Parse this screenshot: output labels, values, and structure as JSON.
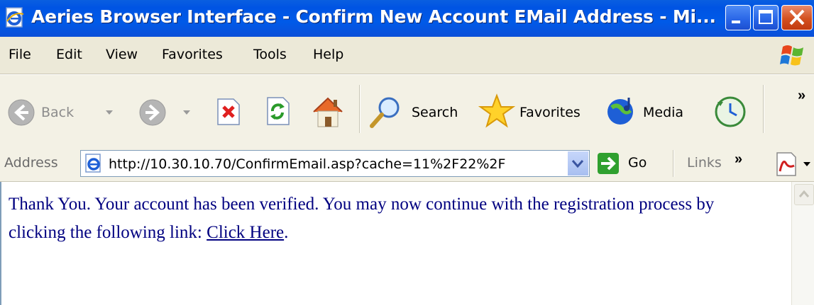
{
  "window": {
    "title": "Aeries Browser Interface - Confirm New Account EMail Address - Mi...",
    "controls": {
      "minimize": "minimize-icon",
      "maximize": "maximize-icon",
      "close": "close-icon"
    }
  },
  "menubar": {
    "items": [
      "File",
      "Edit",
      "View",
      "Favorites",
      "Tools",
      "Help"
    ]
  },
  "toolbar": {
    "back_label": "Back",
    "search_label": "Search",
    "favorites_label": "Favorites",
    "media_label": "Media",
    "icons": [
      "back-icon",
      "forward-icon",
      "stop-icon",
      "refresh-icon",
      "home-icon",
      "search-icon",
      "favorites-icon",
      "media-icon",
      "history-icon"
    ]
  },
  "addressbar": {
    "label": "Address",
    "url": "http://10.30.10.70/ConfirmEmail.asp?cache=11%2F22%2F",
    "go_label": "Go",
    "links_label": "Links"
  },
  "content": {
    "message": "Thank You.  Your account has been verified.  You may now continue with the registration process by clicking the following link: ",
    "link_text": "Click Here",
    "trailing": ".",
    "colors": {
      "text": "#000080",
      "background": "#ffffff"
    }
  },
  "colors": {
    "titlebar": "#0054e3",
    "chrome": "#ece9d8",
    "close_button": "#d3501f"
  }
}
